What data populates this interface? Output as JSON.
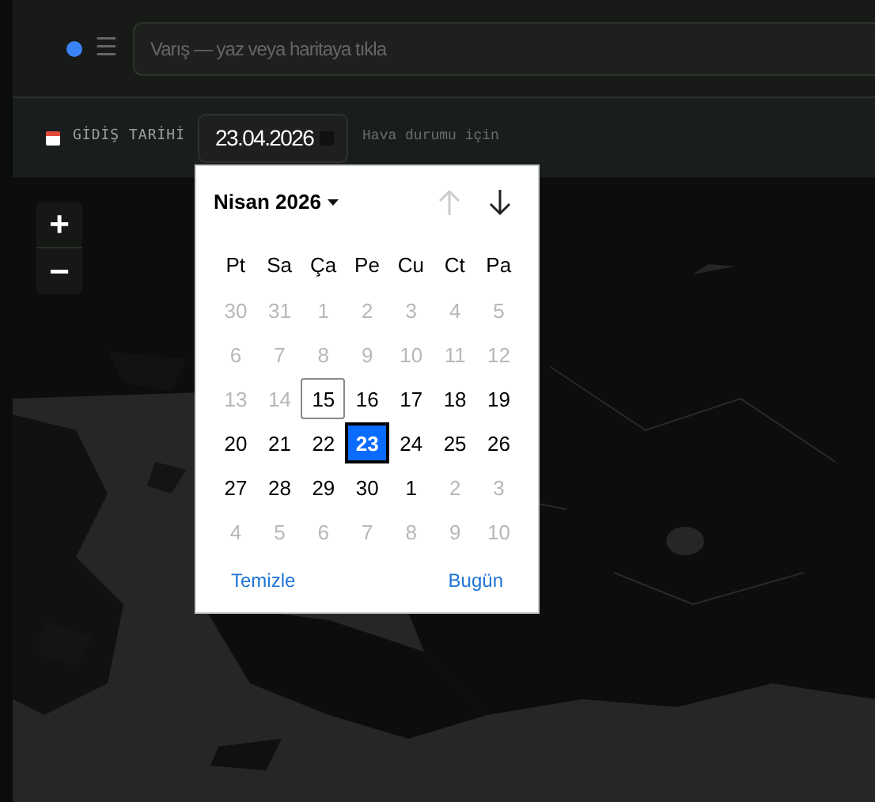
{
  "destination_search": {
    "placeholder": "Varış — yaz veya haritaya tıkla"
  },
  "menu_icon": "☰",
  "date_row": {
    "label": "GİDİŞ TARİHİ",
    "value": "23.04.2026",
    "hint": "Hava durumu için"
  },
  "map_controls": [
    {
      "label": "+"
    },
    {
      "label": "−"
    }
  ],
  "datepicker": {
    "month": "Nisan 2026",
    "prev_disabled": true,
    "next_disabled": false,
    "weekdays": [
      "Pt",
      "Sa",
      "Ça",
      "Pe",
      "Cu",
      "Ct",
      "Pa"
    ],
    "weeks": [
      [
        {
          "day": "30",
          "muted": true,
          "selected": false
        },
        {
          "day": "31",
          "muted": true,
          "selected": false
        },
        {
          "day": "1",
          "muted": true,
          "selected": false
        },
        {
          "day": "2",
          "muted": true,
          "selected": false
        },
        {
          "day": "3",
          "muted": true,
          "selected": false
        },
        {
          "day": "4",
          "muted": true,
          "selected": false
        },
        {
          "day": "5",
          "muted": true,
          "selected": false
        }
      ],
      [
        {
          "day": "6",
          "muted": true,
          "selected": false
        },
        {
          "day": "7",
          "muted": true,
          "selected": false
        },
        {
          "day": "8",
          "muted": true,
          "selected": false
        },
        {
          "day": "9",
          "muted": true,
          "selected": false
        },
        {
          "day": "10",
          "muted": true,
          "selected": false
        },
        {
          "day": "11",
          "muted": true,
          "selected": false
        },
        {
          "day": "12",
          "muted": true,
          "selected": false
        }
      ],
      [
        {
          "day": "13",
          "muted": true,
          "selected": false
        },
        {
          "day": "14",
          "muted": true,
          "selected": false
        },
        {
          "day": "15",
          "muted": false,
          "today": true,
          "selected": false
        },
        {
          "day": "16",
          "muted": false,
          "selected": false
        },
        {
          "day": "17",
          "muted": false,
          "selected": false
        },
        {
          "day": "18",
          "muted": false,
          "selected": false
        },
        {
          "day": "19",
          "muted": false,
          "selected": false
        }
      ],
      [
        {
          "day": "20",
          "muted": false,
          "selected": false
        },
        {
          "day": "21",
          "muted": false,
          "selected": false
        },
        {
          "day": "22",
          "muted": false,
          "selected": false
        },
        {
          "day": "23",
          "muted": false,
          "selected": true
        },
        {
          "day": "24",
          "muted": false,
          "selected": false
        },
        {
          "day": "25",
          "muted": false,
          "selected": false
        },
        {
          "day": "26",
          "muted": false,
          "selected": false
        }
      ],
      [
        {
          "day": "27",
          "muted": false,
          "selected": false
        },
        {
          "day": "28",
          "muted": false,
          "selected": false
        },
        {
          "day": "29",
          "muted": false,
          "selected": false
        },
        {
          "day": "30",
          "muted": false,
          "selected": false
        },
        {
          "day": "1",
          "muted": false,
          "selected": false
        },
        {
          "day": "2",
          "muted": true,
          "selected": false
        },
        {
          "day": "3",
          "muted": true,
          "selected": false
        }
      ],
      [
        {
          "day": "4",
          "muted": true,
          "selected": false
        },
        {
          "day": "5",
          "muted": true,
          "selected": false
        },
        {
          "day": "6",
          "muted": true,
          "selected": false
        },
        {
          "day": "7",
          "muted": true,
          "selected": false
        },
        {
          "day": "8",
          "muted": true,
          "selected": false
        },
        {
          "day": "9",
          "muted": true,
          "selected": false
        },
        {
          "day": "10",
          "muted": true,
          "selected": false
        }
      ]
    ],
    "buttons": [
      "Temizle",
      "Bugün"
    ]
  }
}
